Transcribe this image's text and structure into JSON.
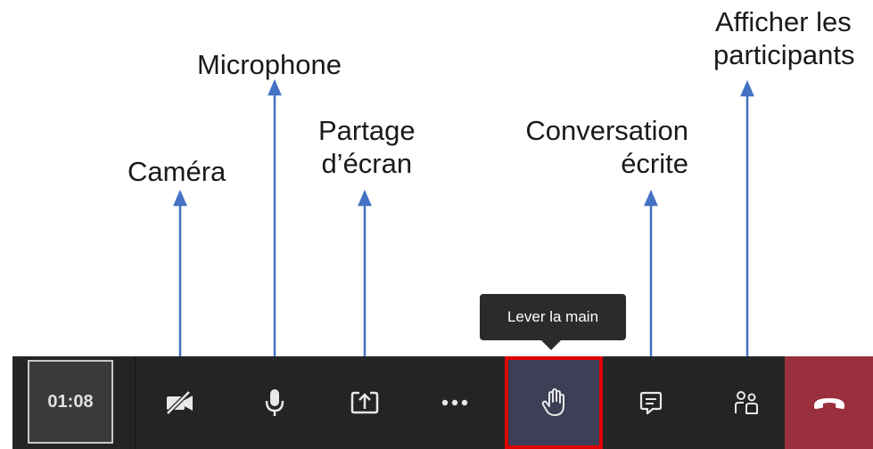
{
  "annotations": {
    "camera": "Caméra",
    "microphone": "Microphone",
    "screen_share_line1": "Partage",
    "screen_share_line2": "d’écran",
    "chat_line1": "Conversation",
    "chat_line2": "écrite",
    "participants_line1": "Afficher les",
    "participants_line2": "participants"
  },
  "tooltip": {
    "text": "Lever la main"
  },
  "toolbar": {
    "timer": "01:08",
    "buttons": [
      {
        "icon": "camera-off-icon"
      },
      {
        "icon": "microphone-icon"
      },
      {
        "icon": "share-screen-icon"
      },
      {
        "icon": "more-options-icon"
      },
      {
        "icon": "raise-hand-icon",
        "highlighted": true
      },
      {
        "icon": "chat-icon"
      },
      {
        "icon": "participants-icon"
      },
      {
        "icon": "hang-up-icon"
      }
    ]
  },
  "colors": {
    "arrow": "#4472c4",
    "toolbar_bg": "#242424",
    "highlight_border": "#e00000",
    "hand_button_bg": "#3d3f56",
    "hangup_bg": "#9a2f3d",
    "tooltip_bg": "#2b2b2b"
  }
}
